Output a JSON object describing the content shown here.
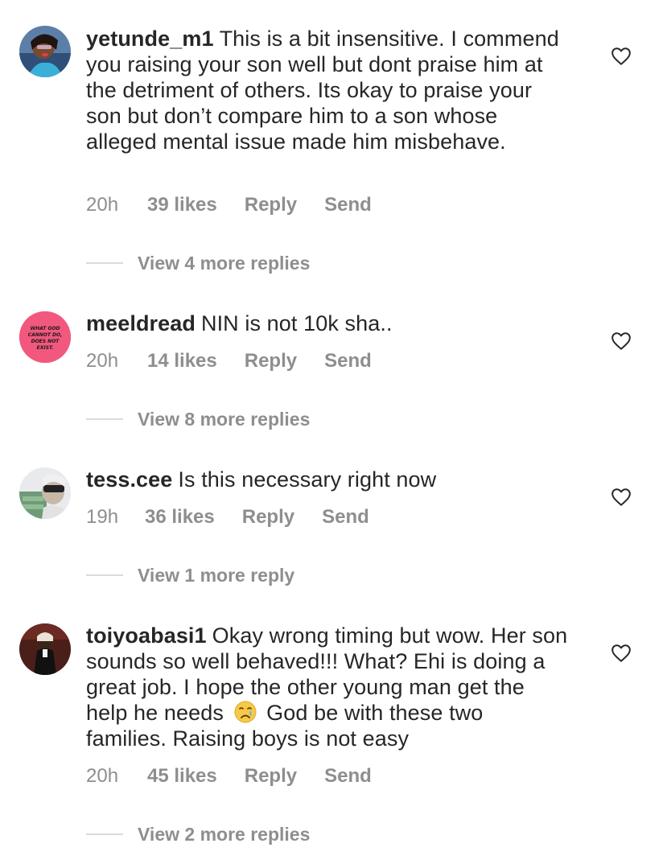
{
  "comments": [
    {
      "username": "yetunde_m1",
      "text": "This is a bit insensitive. I commend you raising your son well but dont praise him at the detriment of others. Its okay to praise your son but don’t compare him to a son whose alleged mental issue made him misbehave.",
      "time": "20h",
      "likes": "39 likes",
      "reply_label": "Reply",
      "send_label": "Send",
      "view_more": "View 4 more replies",
      "avatar_icon": "user-photo-avatar"
    },
    {
      "username": "meeldread",
      "text": "NIN is not 10k sha..",
      "time": "20h",
      "likes": "14 likes",
      "reply_label": "Reply",
      "send_label": "Send",
      "view_more": "View 8 more replies",
      "avatar_text": "WHAT GOD CANNOT DO, DOES NOT EXIST.",
      "avatar_color": "#f2587e"
    },
    {
      "username": "tess.cee",
      "text": "Is this necessary right now",
      "time": "19h",
      "likes": "36 likes",
      "reply_label": "Reply",
      "send_label": "Send",
      "view_more": "View 1 more reply",
      "avatar_icon": "user-photo-avatar"
    },
    {
      "username": "toiyoabasi1",
      "text_part1": "Okay wrong timing but wow. Her son sounds so well behaved!!! What? Ehi is doing a great job. I hope the other young man get the help he needs",
      "text_part2": "God be with these two families. Raising boys is not easy",
      "emoji_icon": "crying-face-emoji",
      "time": "20h",
      "likes": "45 likes",
      "reply_label": "Reply",
      "send_label": "Send",
      "view_more": "View 2 more replies",
      "avatar_icon": "user-photo-avatar"
    }
  ],
  "colors": {
    "text": "#262626",
    "secondary": "#8e8e8e",
    "divider": "#dbdbdb"
  }
}
